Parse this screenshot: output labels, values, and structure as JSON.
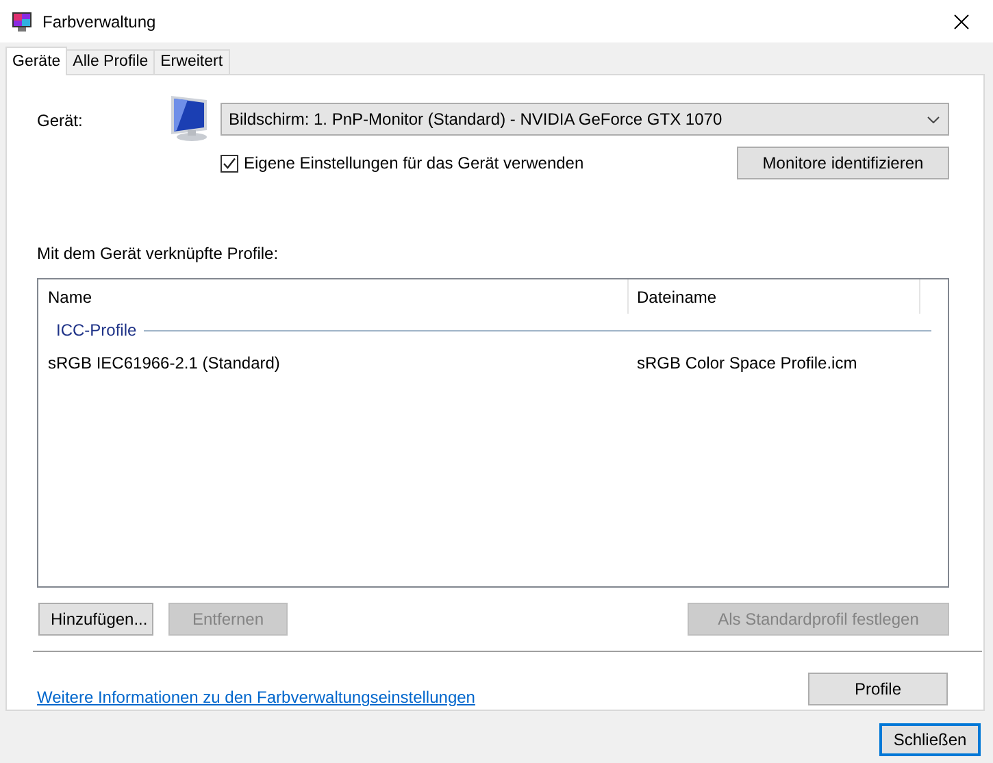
{
  "window": {
    "title": "Farbverwaltung"
  },
  "tabs": [
    {
      "label": "Geräte",
      "selected": true
    },
    {
      "label": "Alle Profile",
      "selected": false
    },
    {
      "label": "Erweitert",
      "selected": false
    }
  ],
  "device": {
    "label": "Gerät:",
    "value": "Bildschirm: 1. PnP-Monitor (Standard) - NVIDIA GeForce GTX 1070",
    "use_own_settings": {
      "label": "Eigene Einstellungen für das Gerät verwenden",
      "checked": true
    },
    "identify_button": "Monitore identifizieren"
  },
  "profiles": {
    "caption": "Mit dem Gerät verknüpfte Profile:",
    "columns": [
      "Name",
      "Dateiname"
    ],
    "groups": [
      {
        "title": "ICC-Profile",
        "rows": [
          {
            "cells": [
              "sRGB IEC61966-2.1 (Standard)",
              "sRGB Color Space Profile.icm"
            ]
          }
        ]
      }
    ]
  },
  "buttons": [
    {
      "label": "Hinzufügen...",
      "disabled": false
    },
    {
      "label": "Entfernen",
      "disabled": true
    },
    {
      "label": "Als Standardprofil festlegen",
      "disabled": true
    }
  ],
  "link": "Weitere Informationen zu den Farbverwaltungseinstellungen",
  "profile_button": "Profile",
  "close_button": "Schließen"
}
